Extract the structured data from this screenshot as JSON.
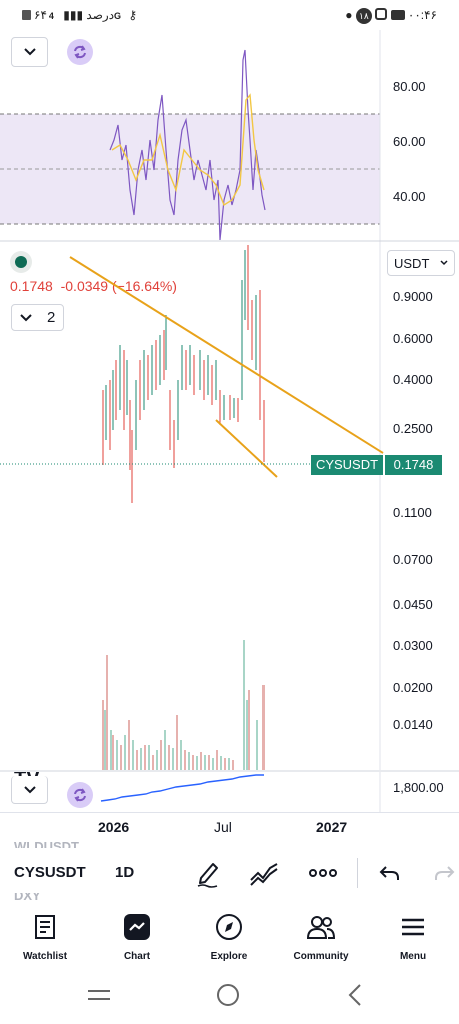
{
  "status_bar": {
    "left_text": "۶۴درصد",
    "network": "4G",
    "time": "۰۰:۴۶",
    "notification_count": "۱۸"
  },
  "indicator_pane": {
    "y_ticks": [
      "80.00",
      "60.00",
      "40.00"
    ]
  },
  "price_pane": {
    "last_price": "0.1748",
    "change": "-0.0349",
    "change_pct": "(−16.64%)",
    "legend_count": "2",
    "currency": "USDT",
    "y_ticks": [
      "0.9000",
      "0.6000",
      "0.4000",
      "0.2500",
      "0.1100",
      "0.0700",
      "0.0450",
      "0.0300",
      "0.0200",
      "0.0140"
    ],
    "symbol_tag": "CYSUSDT",
    "price_tag": "0.1748"
  },
  "compare_pane": {
    "y_tick": "1,800.00"
  },
  "time_axis": {
    "labels": [
      "2026",
      "Jul",
      "2027"
    ]
  },
  "toolbar": {
    "ghost_above": "WLDUSDT",
    "symbol": "CYSUSDT",
    "interval": "1D",
    "ghost_below": "DXY"
  },
  "bottom_nav": {
    "items": [
      {
        "label": "Watchlist",
        "icon": "watchlist-icon"
      },
      {
        "label": "Chart",
        "icon": "chart-icon"
      },
      {
        "label": "Explore",
        "icon": "compass-icon"
      },
      {
        "label": "Community",
        "icon": "community-icon"
      },
      {
        "label": "Menu",
        "icon": "menu-icon"
      }
    ]
  },
  "colors": {
    "accent_orange": "#e8a21a",
    "green": "#1b8a72",
    "red": "#e0413a",
    "rsi_purple": "#7e57c2",
    "rsi_band": "#ede7f6"
  }
}
